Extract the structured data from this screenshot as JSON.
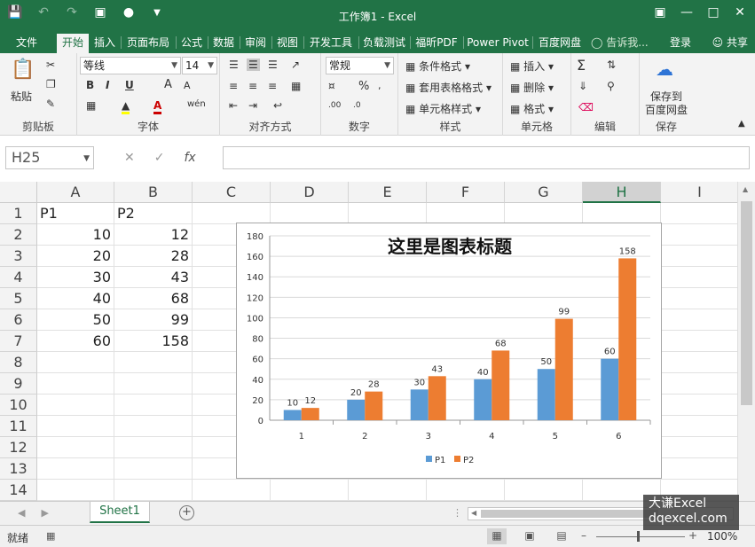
{
  "window": {
    "title": "工作簿1 - Excel",
    "qat_icons": [
      "save-icon",
      "undo-icon",
      "redo-icon",
      "camera-icon",
      "touch-mode-icon",
      "customize-icon"
    ],
    "controls": [
      "ribbon-display-icon",
      "minimize-icon",
      "restore-icon",
      "close-icon"
    ]
  },
  "tabs": [
    "文件",
    "开始",
    "插入",
    "页面布局",
    "公式",
    "数据",
    "审阅",
    "视图",
    "开发工具",
    "负载测试",
    "福昕PDF",
    "Power Pivot",
    "百度网盘"
  ],
  "active_tab": "开始",
  "tell_me": "告诉我...",
  "login": "登录",
  "share": "共享",
  "ribbon": {
    "clipboard": {
      "label": "剪贴板",
      "paste": "粘贴"
    },
    "font": {
      "label": "字体",
      "name": "等线",
      "size": "14",
      "bold": "B",
      "italic": "I",
      "underline": "U",
      "grow": "A",
      "shrink": "A"
    },
    "alignment": {
      "label": "对齐方式"
    },
    "number": {
      "label": "数字",
      "format": "常规",
      "percent": "%"
    },
    "styles": {
      "label": "样式",
      "conditional": "条件格式",
      "table": "套用表格格式",
      "cell": "单元格样式"
    },
    "cells": {
      "label": "单元格",
      "insert": "插入",
      "delete": "删除",
      "format": "格式"
    },
    "editing": {
      "label": "编辑"
    },
    "save": {
      "label": "保存",
      "button_line1": "保存到",
      "button_line2": "百度网盘"
    }
  },
  "formula_bar": {
    "name_box": "H25",
    "fx": "fx",
    "value": ""
  },
  "columns": [
    "A",
    "B",
    "C",
    "D",
    "E",
    "F",
    "G",
    "H",
    "I"
  ],
  "active_column": "H",
  "rows": [
    "1",
    "2",
    "3",
    "4",
    "5",
    "6",
    "7",
    "8",
    "9",
    "10",
    "11",
    "12",
    "13",
    "14"
  ],
  "cells": {
    "A1": "P1",
    "B1": "P2",
    "A2": "10",
    "B2": "12",
    "A3": "20",
    "B3": "28",
    "A4": "30",
    "B4": "43",
    "A5": "40",
    "B5": "68",
    "A6": "50",
    "B6": "99",
    "A7": "60",
    "B7": "158"
  },
  "chart_data": {
    "type": "bar",
    "title": "这里是图表标题",
    "categories": [
      "1",
      "2",
      "3",
      "4",
      "5",
      "6"
    ],
    "series": [
      {
        "name": "P1",
        "values": [
          10,
          20,
          30,
          40,
          50,
          60
        ],
        "color": "#5b9bd5"
      },
      {
        "name": "P2",
        "values": [
          12,
          28,
          43,
          68,
          99,
          158
        ],
        "color": "#ed7d31"
      }
    ],
    "ylim": [
      0,
      180
    ],
    "yticks": [
      0,
      20,
      40,
      60,
      80,
      100,
      120,
      140,
      160,
      180
    ],
    "grid": true,
    "legend": "bottom",
    "data_labels": true
  },
  "sheet": {
    "tab": "Sheet1"
  },
  "status": {
    "ready": "就绪",
    "zoom": "100%"
  },
  "watermark": {
    "line1": "大谦Excel",
    "line2": "dqexcel.com"
  }
}
